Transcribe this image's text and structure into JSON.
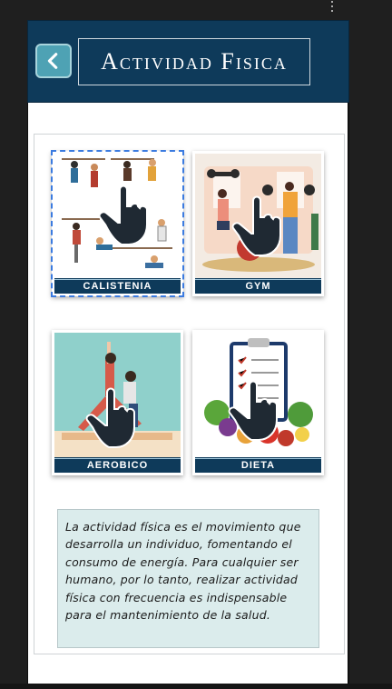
{
  "header": {
    "title": "Actividad Fisica",
    "back_icon": "chevron-left-icon",
    "background": "#0e3a5a",
    "back_button_color": "#4ea2b4"
  },
  "cards": [
    {
      "label": "CALISTENIA",
      "icon": "calisthenics-illustration"
    },
    {
      "label": "GYM",
      "icon": "gym-illustration"
    },
    {
      "label": "AEROBICO",
      "icon": "aerobic-illustration"
    },
    {
      "label": "DIETA",
      "icon": "diet-illustration"
    }
  ],
  "description": "La actividad física es el movimiento que desarrolla un individuo, fomentando el consumo de energía. Para cualquier ser humano, por lo tanto, realizar actividad física con frecuencia es indispensable para el mantenimiento de la salud.",
  "colors": {
    "label_bar": "#0e3a5a",
    "description_bg": "#dbecec"
  }
}
